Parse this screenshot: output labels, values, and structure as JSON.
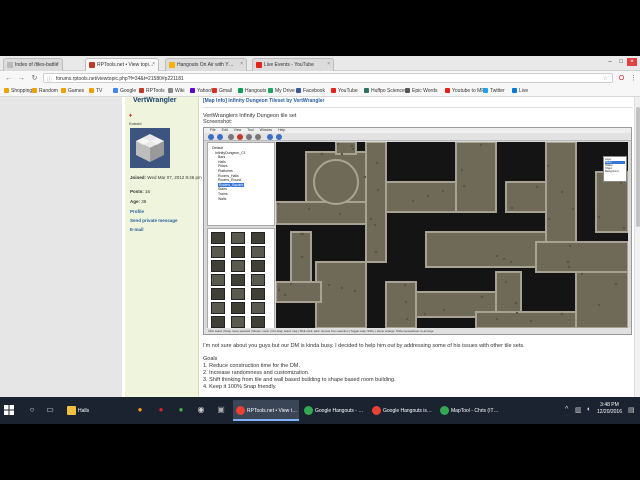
{
  "browser": {
    "tabs": [
      {
        "label": "Index of /tiles-battle",
        "color": "#bbb"
      },
      {
        "label": "RPTools.net • View topi…",
        "color": "#c0392b"
      },
      {
        "label": "Hangouts On Air with Y…",
        "color": "#f4b400"
      },
      {
        "label": "Live Events - YouTube",
        "color": "#e62117"
      }
    ],
    "url": "forums.rptools.net/viewtopic.php?f=34&t=21580#p221181",
    "bookmarks": [
      {
        "label": "Shopping",
        "color": "#f0a000"
      },
      {
        "label": "Random",
        "color": "#f0a000"
      },
      {
        "label": "Games",
        "color": "#f0a000"
      },
      {
        "label": "TV",
        "color": "#f0a000"
      },
      {
        "label": "Google",
        "color": "#4285f4"
      },
      {
        "label": "RPTools",
        "color": "#c0392b"
      },
      {
        "label": "Wiki",
        "color": "#888"
      },
      {
        "label": "Yahoo!",
        "color": "#6001d2"
      },
      {
        "label": "Gmail",
        "color": "#d93025"
      },
      {
        "label": "Hangouts",
        "color": "#0f9d58"
      },
      {
        "label": "My Drive",
        "color": "#1fa463"
      },
      {
        "label": "Facebook",
        "color": "#3b5998"
      },
      {
        "label": "YouTube",
        "color": "#e62117"
      },
      {
        "label": "Huffpo Science",
        "color": "#2e7061"
      },
      {
        "label": "Epic Words",
        "color": "#555"
      },
      {
        "label": "Youtube to MP3",
        "color": "#e62117"
      },
      {
        "label": "Twitter",
        "color": "#1da1f2"
      },
      {
        "label": "Live",
        "color": "#0078d7"
      }
    ]
  },
  "profile": {
    "username": "VertWrangler",
    "role": "Kobold",
    "joined_label": "Joined:",
    "joined_value": "Wed Mar 07, 2012 8:46 pm",
    "posts_label": "Posts:",
    "posts_value": "16",
    "age_label": "Age:",
    "age_value": "38",
    "links": [
      "Profile",
      "Send private message",
      "E-mail"
    ]
  },
  "post": {
    "title": "[Map Info] Infinity Dungeon Tileset by VertWrangler",
    "line1": "VertWranglers Infinity Dungeon tile set",
    "line2": "Screenshot:",
    "screenshot": {
      "menu": [
        "File",
        "Edit",
        "View",
        "Tool",
        "Window",
        "Help"
      ],
      "tree": [
        "Default",
        "InfinityDungeon_C1",
        "Bars",
        "Halls",
        "Pillars",
        "Platforms",
        "Rooms_Halls",
        "Rooms_Round",
        "Rooms_Square",
        "Stairs",
        "Trains",
        "Walls"
      ],
      "tree_selected": "Rooms_Square",
      "panel": [
        "Layer",
        "Token",
        "Hidden",
        "Object",
        "Background"
      ],
      "panel_selected": "Token",
      "status": "Click select | Drag: move selected | Mouse: zoom | Ctrl-drag: select map | Shift+click: add / remove from selection | Toggle snap: Shift+ | Hover enlarge: Shift+mousewheel: re-arrange"
    },
    "body": [
      "I'm not sure about you guys but our DM is kinda busy. I decided to help him out by addressing some of his issues with other tile sets.",
      "Goals",
      "1. Reduce construction time for the DM.",
      "2. Increase randomness and customization.",
      "3. Shift thinking from tile and wall based building to shape based room building.",
      "4. Keep it 100% Snap friendly."
    ]
  },
  "taskbar": {
    "search_icon": "search-icon",
    "apps": [
      {
        "label": "Halls",
        "color": "#f0c040"
      },
      {
        "label": "RPTools.net • View t…",
        "color": "#e94235"
      },
      {
        "label": "Google Hangouts - …",
        "color": "#34a853"
      },
      {
        "label": "Google Hangouts is…",
        "color": "#e94235"
      },
      {
        "label": "MapTool - Chris (IT…",
        "color": "#34a853"
      }
    ],
    "time": "3:48 PM",
    "date": "12/20/2016"
  }
}
